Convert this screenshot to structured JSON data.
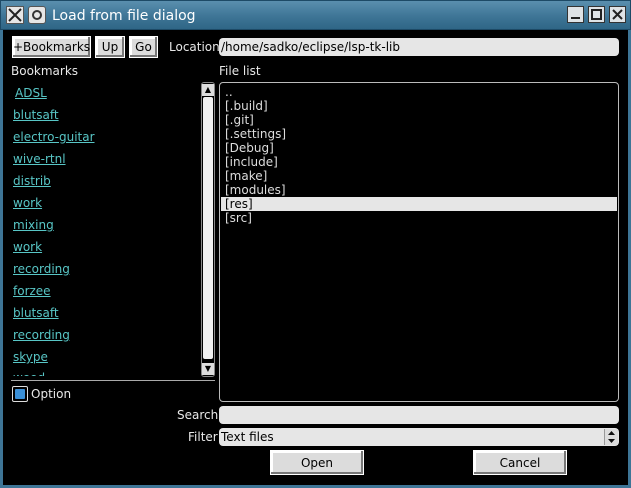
{
  "window": {
    "title": "Load from file dialog"
  },
  "toolbar": {
    "add_bookmark": "+Bookmarks",
    "up": "Up",
    "go": "Go"
  },
  "location": {
    "label": "Location",
    "value": "/home/sadko/eclipse/lsp-tk-lib"
  },
  "bookmarks": {
    "label": "Bookmarks",
    "items": [
      "ADSL",
      "blutsaft",
      "electro-guitar",
      "wive-rtnl",
      "distrib",
      "work",
      "mixing",
      "work",
      "recording",
      "forzee",
      "blutsaft",
      "recording",
      "skype",
      "wood"
    ]
  },
  "file_list": {
    "label": "File list",
    "items": [
      "..",
      "[.build]",
      "[.git]",
      "[.settings]",
      "[Debug]",
      "[include]",
      "[make]",
      "[modules]",
      "[res]",
      "[src]"
    ],
    "selected_index": 8
  },
  "option": {
    "label": "Option"
  },
  "search": {
    "label": "Search",
    "value": ""
  },
  "filter": {
    "label": "Filter",
    "value": "Text files"
  },
  "actions": {
    "open": "Open",
    "cancel": "Cancel"
  },
  "colors": {
    "titlebar": "#3e7596",
    "link": "#58c6c6",
    "selected_row": "#e6e6e6",
    "checkbox": "#3a8fd6"
  }
}
